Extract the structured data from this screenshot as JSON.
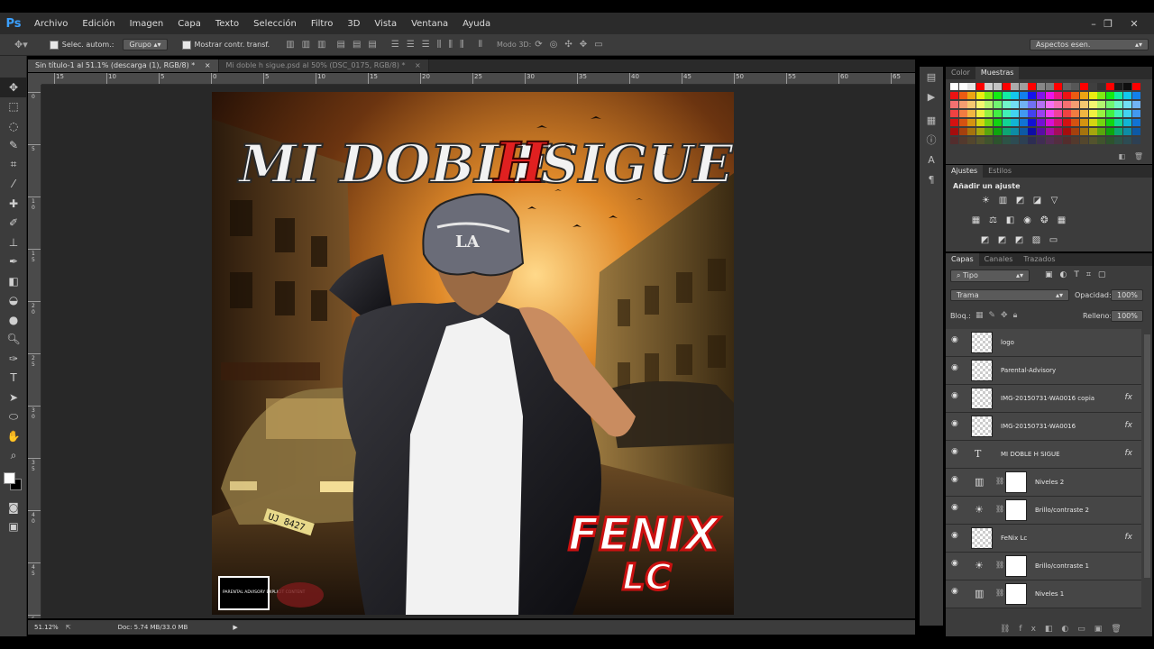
{
  "app": {
    "logo": "Ps"
  },
  "menu": [
    "Archivo",
    "Edición",
    "Imagen",
    "Capa",
    "Texto",
    "Selección",
    "Filtro",
    "3D",
    "Vista",
    "Ventana",
    "Ayuda"
  ],
  "window_controls": {
    "minimize": "–",
    "restore": "❐",
    "close": "✕"
  },
  "options_bar": {
    "auto_select_label": "Selec. autom.:",
    "auto_select_value": "Grupo",
    "show_transform_label": "Mostrar contr. transf.",
    "mode_3d_label": "Modo 3D:",
    "workspace": "Aspectos esen."
  },
  "doc_tabs": [
    {
      "label": "Sin título-1 al 51.1% (descarga (1), RGB/8) *",
      "close": "×"
    },
    {
      "label": "Mi doble h sigue.psd al 50% (DSC_0175, RGB/8) *",
      "close": "×"
    }
  ],
  "ruler": {
    "h_ticks": [
      "15",
      "10",
      "5",
      "0",
      "5",
      "10",
      "15",
      "20",
      "25",
      "30",
      "35",
      "40",
      "45",
      "50",
      "55",
      "60",
      "65"
    ],
    "v_ticks": [
      "0",
      "5",
      "1\n0",
      "1\n5",
      "2\n0",
      "2\n5",
      "3\n0",
      "3\n5",
      "4\n0",
      "4\n5",
      "5\n0"
    ]
  },
  "artwork": {
    "title_left": "MI DOBLE",
    "title_h": "H",
    "title_right": "SIGUE",
    "cap_text": "LA",
    "brand_main": "FENIX",
    "brand_sub": "LC",
    "plate": "UJ 8427",
    "advisory": "PARENTAL ADVISORY EXPLICIT CONTENT"
  },
  "status_bar": {
    "zoom": "51.12%",
    "doc": "Doc: 5.74 MB/33.0 MB",
    "arrow": "▶"
  },
  "swatches_panel": {
    "tabs": [
      "Color",
      "Muestras"
    ],
    "active": "Muestras"
  },
  "adjustments_panel": {
    "tabs": [
      "Ajustes",
      "Estilos"
    ],
    "active": "Ajustes",
    "heading": "Añadir un ajuste"
  },
  "layers_panel": {
    "tabs": [
      "Capas",
      "Canales",
      "Trazados"
    ],
    "active": "Capas",
    "filter": "Tipo",
    "blend_mode": "Trama",
    "opacity_label": "Opacidad:",
    "opacity": "100%",
    "lock_label": "Bloq.:",
    "fill_label": "Relleno:",
    "fill": "100%",
    "layers": [
      {
        "name": "logo",
        "kind": "image",
        "fx": false
      },
      {
        "name": "Parental-Advisory",
        "kind": "image",
        "fx": false
      },
      {
        "name": "IMG-20150731-WA0016 copia",
        "kind": "image",
        "fx": true
      },
      {
        "name": "IMG-20150731-WA0016",
        "kind": "image",
        "fx": true
      },
      {
        "name": "MI DOBLE H SIGUE",
        "kind": "text",
        "fx": true
      },
      {
        "name": "Niveles 2",
        "kind": "levels",
        "fx": false
      },
      {
        "name": "Brillo/contraste 2",
        "kind": "brightness",
        "fx": false
      },
      {
        "name": "FeNix Lc",
        "kind": "image",
        "fx": true
      },
      {
        "name": "Brillo/contraste 1",
        "kind": "brightness",
        "fx": false
      },
      {
        "name": "Niveles 1",
        "kind": "levels",
        "fx": false
      }
    ]
  },
  "colors": {
    "accent": "#3ba0ff",
    "ui_dark": "#3c3c3c",
    "title_red": "#e02020"
  }
}
